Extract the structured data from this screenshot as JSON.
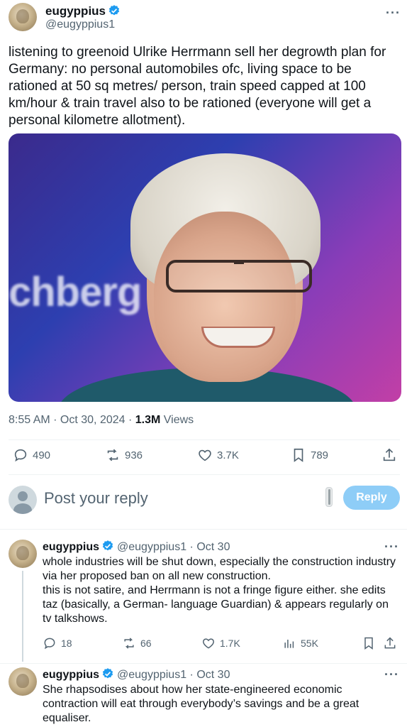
{
  "main_tweet": {
    "author_name": "eugyppius",
    "handle": "@eugyppius1",
    "more": "···",
    "text": "listening to greenoid Ulrike Herrmann sell her degrowth plan for Germany: no personal automobiles ofc, living space to be rationed at 50 sq metres/ person, train speed capped at 100 km/hour & train travel also to be rationed (everyone will get a personal kilometre allotment).",
    "image_text": "chberg",
    "time": "8:55 AM · Oct 30, 2024 · ",
    "views_count": "1.3M",
    "views_label": " Views",
    "stats": {
      "replies": "490",
      "reposts": "936",
      "likes": "3.7K",
      "bookmarks": "789"
    }
  },
  "reply_composer": {
    "placeholder": "Post your reply",
    "button": "Reply"
  },
  "thread": [
    {
      "author_name": "eugyppius",
      "handle": "@eugyppius1",
      "date": " · Oct 30",
      "more": "···",
      "text": "whole industries will be shut down, especially the construction industry via her proposed ban on all new construction.\nthis is not satire, and Herrmann is not a fringe figure either. she edits taz (basically, a German- language Guardian) & appears regularly on tv talkshows.",
      "stats": {
        "replies": "18",
        "reposts": "66",
        "likes": "1.7K",
        "views": "55K"
      }
    },
    {
      "author_name": "eugyppius",
      "handle": "@eugyppius1",
      "date": " · Oct 30",
      "more": "···",
      "text": "She rhapsodises about how her state-engineered economic contraction will eat through everybody’s savings and be a great equaliser."
    }
  ],
  "colors": {
    "verified": "#1d9bf0",
    "reply_button": "#8ecdf7",
    "secondary_text": "#536471"
  }
}
